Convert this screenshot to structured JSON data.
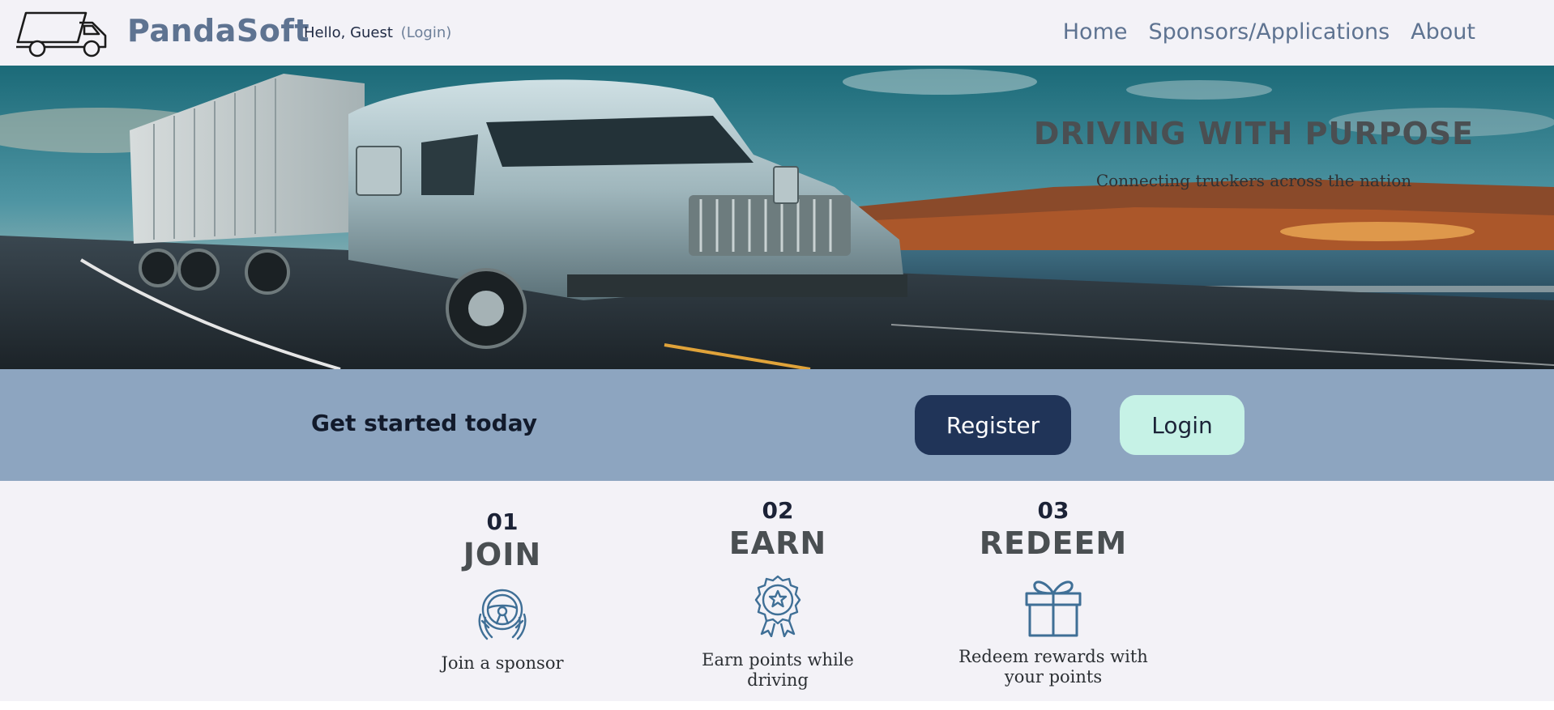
{
  "header": {
    "brand": "PandaSoft",
    "greeting_prefix": "Hello, Guest",
    "greeting_login": "(Login)",
    "nav": [
      "Home",
      "Sponsors/Applications",
      "About"
    ]
  },
  "hero": {
    "title": "DRIVING WITH PURPOSE",
    "subtitle": "Connecting truckers across the nation"
  },
  "cta": {
    "text": "Get started today",
    "register_label": "Register",
    "login_label": "Login"
  },
  "steps": [
    {
      "number": "01",
      "title": "JOIN",
      "description": "Join a sponsor",
      "icon": "steering-wheel-hands-icon"
    },
    {
      "number": "02",
      "title": "EARN",
      "description": "Earn points while driving",
      "icon": "award-ribbon-icon"
    },
    {
      "number": "03",
      "title": "REDEEM",
      "description": "Redeem rewards with your points",
      "icon": "gift-box-icon"
    }
  ],
  "colors": {
    "brand": "#5e7391",
    "primary_button": "#203458",
    "secondary_button": "#c6f2e6",
    "cta_band": "#8da5c0",
    "icon": "#3f6f96"
  }
}
